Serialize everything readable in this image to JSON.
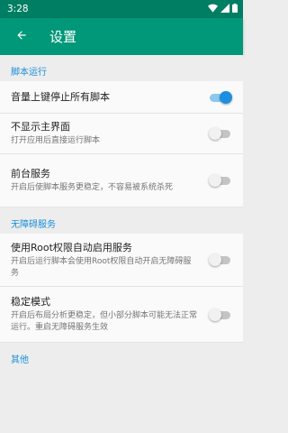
{
  "status_bar": {
    "time": "3:28",
    "icons": [
      "wifi-icon",
      "signal-icon",
      "battery-icon"
    ]
  },
  "app_bar": {
    "back_icon": "arrow-back-icon",
    "title": "设置"
  },
  "colors": {
    "app_bar": "#009879",
    "status_bar": "#007e63",
    "section_header": "#1a8fd6",
    "switch_on": "#1d8fe0"
  },
  "sections": [
    {
      "header": "脚本运行"
    },
    {
      "header": "无障碍服务"
    },
    {
      "header": "其他"
    }
  ],
  "prefs": {
    "volume_stop": {
      "title": "音量上键停止所有脚本",
      "checked": true
    },
    "hide_main": {
      "title": "不显示主界面",
      "summary": "打开应用后直接运行脚本",
      "checked": false
    },
    "foreground": {
      "title": "前台服务",
      "summary": "开启后使脚本服务更稳定，不容易被系统杀死",
      "checked": false
    },
    "root_a11y": {
      "title": "使用Root权限自动启用服务",
      "summary": "开启后运行脚本会使用Root权限自动开启无障碍服务",
      "checked": false
    },
    "stable_mode": {
      "title": "稳定模式",
      "summary": "开启后布局分析更稳定，但小部分脚本可能无法正常运行。重启无障碍服务生效",
      "checked": false
    }
  }
}
